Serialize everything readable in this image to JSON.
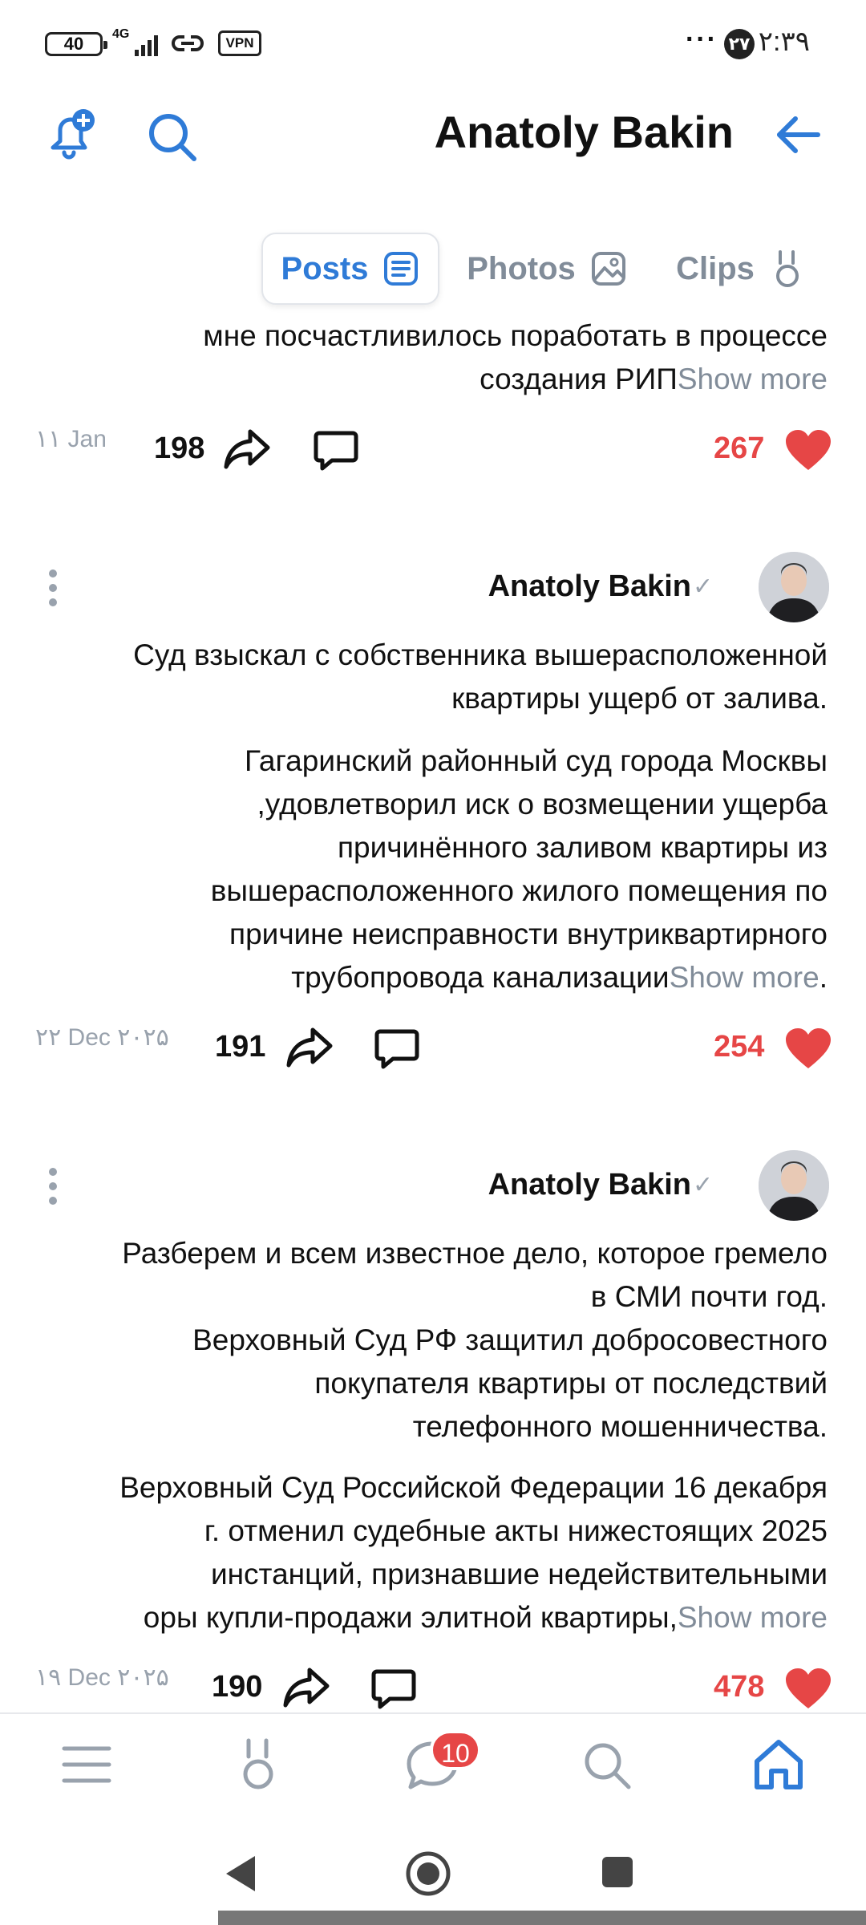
{
  "status_bar": {
    "battery": "40",
    "network": "4G",
    "vpn": "VPN",
    "time": "۲:۳۹",
    "notif_count": "۲۷",
    "dots": "···"
  },
  "header": {
    "title": "Anatoly Bakin"
  },
  "tabs": [
    {
      "label": "Posts",
      "active": true
    },
    {
      "label": "Photos",
      "active": false
    },
    {
      "label": "Clips",
      "active": false
    }
  ],
  "show_more_label": "Show more",
  "posts": [
    {
      "lines": [
        "мне посчастливилось поработать в процессе"
      ],
      "last_line": "создания РИП",
      "date": "۱۱ Jan",
      "reposts": "198",
      "likes": "267"
    },
    {
      "author": "Anatoly Bakin",
      "title_lines": [
        "Суд взыскал с собственника вышерасположенной",
        ".квартиры ущерб от залива"
      ],
      "body_lines": [
        "Гагаринский районный суд города Москвы",
        "удовлетворил иск о возмещении ущерба,",
        "причинённого заливом квартиры из",
        "вышерасположенного жилого помещения по",
        "причине неисправности внутриквартирного"
      ],
      "last_line": ".трубопровода канализации",
      "date": "۲۲ Dec ۲۰۲۵",
      "reposts": "191",
      "likes": "254"
    },
    {
      "author": "Anatoly Bakin",
      "title_lines": [
        "Разберем и всем известное дело, которое гремело",
        ".в СМИ почти год",
        "Верховный Суд РФ защитил добросовестного",
        "покупателя квартиры от последствий",
        ".телефонного мошенничества"
      ],
      "body_lines": [
        "Верховный Суд Российской Федерации 16 декабря",
        "2025 г. отменил судебные акты нижестоящих",
        "инстанций, признавшие недействительными"
      ],
      "last_line": "оры купли-продажи элитной квартиры,",
      "date": "۱۹ Dec ۲۰۲۵",
      "reposts": "190",
      "likes": "478"
    }
  ],
  "bottom_nav": {
    "items": [
      "menu-icon",
      "clips-icon",
      "messages-icon",
      "search-icon",
      "home-icon"
    ],
    "messages_badge": "10"
  },
  "colors": {
    "accent": "#2f7bd7",
    "like": "#e64646",
    "muted": "#818c99"
  }
}
